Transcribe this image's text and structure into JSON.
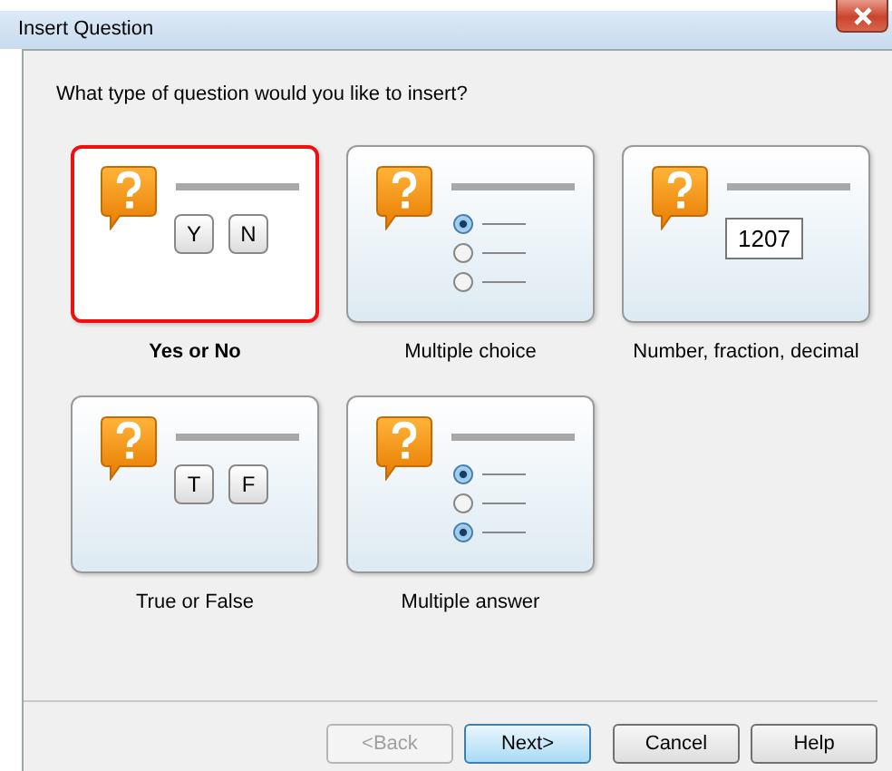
{
  "window": {
    "title": "Insert Question"
  },
  "prompt": "What type of question would you like to insert?",
  "question_types": [
    {
      "kind": "keys",
      "label": "Yes or No",
      "selected": true,
      "keys": [
        "Y",
        "N"
      ]
    },
    {
      "kind": "radios",
      "label": "Multiple choice",
      "selected": false,
      "options": [
        {
          "checked": true
        },
        {
          "checked": false
        },
        {
          "checked": false
        }
      ]
    },
    {
      "kind": "number",
      "label": "Number, fraction, decimal",
      "selected": false,
      "value": "1207"
    },
    {
      "kind": "keys",
      "label": "True or False",
      "selected": false,
      "keys": [
        "T",
        "F"
      ]
    },
    {
      "kind": "radios",
      "label": "Multiple answer",
      "selected": false,
      "options": [
        {
          "checked": true
        },
        {
          "checked": false
        },
        {
          "checked": true
        }
      ]
    }
  ],
  "buttons": [
    {
      "label": "<Back",
      "disabled": true,
      "default": false
    },
    {
      "label": "Next>",
      "disabled": false,
      "default": true
    },
    {
      "label": "Cancel",
      "disabled": false,
      "default": false
    },
    {
      "label": "Help",
      "disabled": false,
      "default": false
    }
  ]
}
